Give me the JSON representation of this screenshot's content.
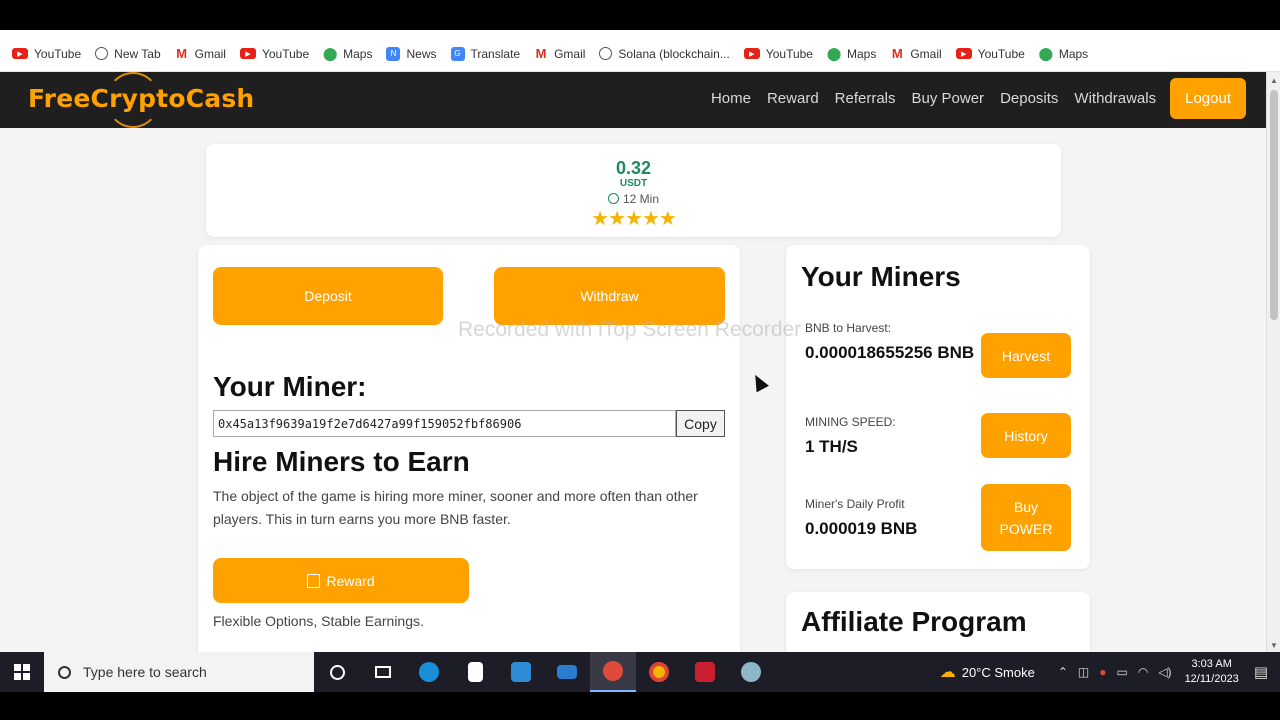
{
  "bookmarks": [
    {
      "label": "YouTube",
      "icon": "youtube-icon"
    },
    {
      "label": "New Tab",
      "icon": "globe-icon"
    },
    {
      "label": "Gmail",
      "icon": "gmail-icon"
    },
    {
      "label": "YouTube",
      "icon": "youtube-icon"
    },
    {
      "label": "Maps",
      "icon": "maps-icon"
    },
    {
      "label": "News",
      "icon": "news-icon"
    },
    {
      "label": "Translate",
      "icon": "translate-icon"
    },
    {
      "label": "Gmail",
      "icon": "gmail-icon"
    },
    {
      "label": "Solana (blockchain...",
      "icon": "globe-icon"
    },
    {
      "label": "YouTube",
      "icon": "youtube-icon"
    },
    {
      "label": "Maps",
      "icon": "maps-icon"
    },
    {
      "label": "Gmail",
      "icon": "gmail-icon"
    },
    {
      "label": "YouTube",
      "icon": "youtube-icon"
    },
    {
      "label": "Maps",
      "icon": "maps-icon"
    }
  ],
  "site": {
    "logo": "FreeCryptoCash",
    "nav": [
      "Home",
      "Reward",
      "Referrals",
      "Buy Power",
      "Deposits",
      "Withdrawals"
    ],
    "logout": "Logout",
    "accent": "#ffa200"
  },
  "stat": {
    "value": "0.32",
    "unit": "USDT",
    "time": "12 Min",
    "stars": "★★★★★",
    "rating": 5
  },
  "main": {
    "deposit": "Deposit",
    "withdraw": "Withdraw",
    "your_miner": "Your Miner:",
    "address": "0x45a13f9639a19f2e7d6427a99f159052fbf86906",
    "copy": "Copy",
    "hire_title": "Hire Miners to Earn",
    "hire_desc": "The object of the game is hiring more miner, sooner and more often than other players. This in turn earns you more BNB faster.",
    "reward": "Reward",
    "flex": "Flexible Options, Stable Earnings."
  },
  "miners": {
    "title": "Your Miners",
    "harvest_label": "BNB to Harvest:",
    "harvest_value": "0.000018655256 BNB",
    "harvest_btn": "Harvest",
    "speed_label": "MINING SPEED:",
    "speed_value": "1 TH/S",
    "history_btn": "History",
    "profit_label": "Miner's Daily Profit",
    "profit_value": "0.000019 BNB",
    "buy_btn": "Buy POWER"
  },
  "affiliate": {
    "title": "Affiliate Program"
  },
  "watermark": "Recorded with iTop Screen Recorder",
  "taskbar": {
    "search_placeholder": "Type here to search",
    "weather": "20°C  Smoke",
    "time": "3:03 AM",
    "date": "12/11/2023"
  }
}
